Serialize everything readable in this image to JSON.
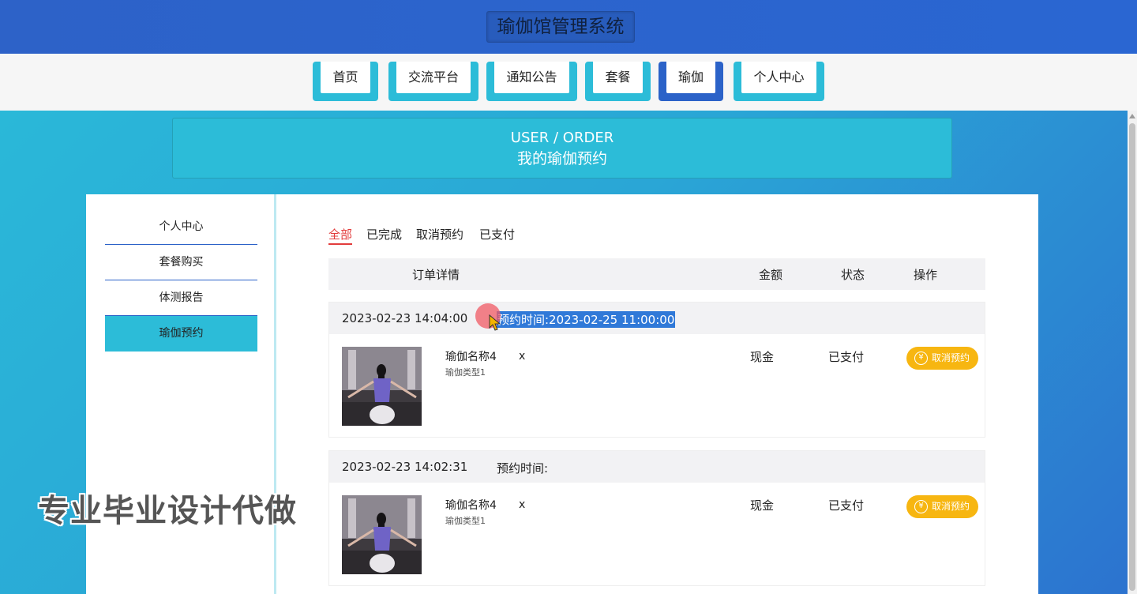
{
  "header": {
    "title": "瑜伽馆管理系统"
  },
  "nav": {
    "items": [
      {
        "label": "首页"
      },
      {
        "label": "交流平台"
      },
      {
        "label": "通知公告"
      },
      {
        "label": "套餐"
      },
      {
        "label": "瑜伽",
        "active": true
      },
      {
        "label": "个人中心"
      }
    ]
  },
  "banner": {
    "en": "USER / ORDER",
    "cn": "我的瑜伽预约"
  },
  "sidebar": {
    "items": [
      {
        "label": "个人中心"
      },
      {
        "label": "套餐购买"
      },
      {
        "label": "体测报告"
      },
      {
        "label": "瑜伽预约",
        "active": true
      }
    ]
  },
  "tabs": [
    {
      "label": "全部",
      "active": true
    },
    {
      "label": "已完成"
    },
    {
      "label": "取消预约"
    },
    {
      "label": "已支付"
    }
  ],
  "table": {
    "headers": {
      "detail": "订单详情",
      "amount": "金额",
      "status": "状态",
      "action": "操作"
    }
  },
  "orders": [
    {
      "created": "2023-02-23 14:04:00",
      "appointment": "预约时间:2023-02-25 11:00:00",
      "name": "瑜伽名称4",
      "type": "瑜伽类型1",
      "qty": "x",
      "amount": "现金",
      "status": "已支付",
      "action": "取消预约",
      "action_icon": "¥"
    },
    {
      "created": "2023-02-23 14:02:31",
      "appointment": "预约时间:",
      "name": "瑜伽名称4",
      "type": "瑜伽类型1",
      "qty": "x",
      "amount": "现金",
      "status": "已支付",
      "action": "取消预约",
      "action_icon": "¥"
    }
  ],
  "watermark": "专业毕业设计代做",
  "colors": {
    "primary": "#2b62c8",
    "accent": "#2cbcd8",
    "button": "#f7b611",
    "active_tab": "#e23c3c"
  }
}
